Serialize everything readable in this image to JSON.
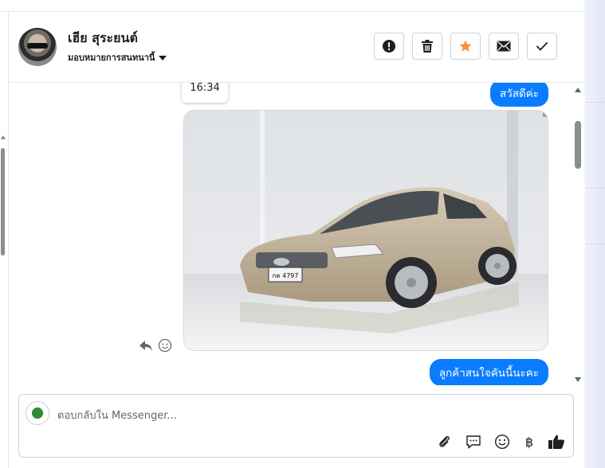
{
  "contact": {
    "name": "เฮีย สุระยนต์",
    "assign_label": "มอบหมายการสนทนานี้"
  },
  "header_actions": [
    {
      "name": "spam-button",
      "icon": "alert-circle-icon"
    },
    {
      "name": "delete-button",
      "icon": "trash-icon"
    },
    {
      "name": "star-button",
      "icon": "star-icon",
      "color": "#f7923b"
    },
    {
      "name": "mark-unread-button",
      "icon": "envelope-icon"
    },
    {
      "name": "mark-done-button",
      "icon": "check-icon"
    }
  ],
  "conversation": {
    "timestamp": "16:34",
    "messages": [
      {
        "type": "text",
        "from": "page",
        "text": "สวัสดีค่ะ"
      },
      {
        "type": "image",
        "from": "page",
        "plate_text": "กต 4797"
      },
      {
        "type": "text",
        "from": "page",
        "text": "ลูกค้าสนใจคันนี้นะคะ"
      }
    ]
  },
  "composer": {
    "placeholder": "ตอบกลับใน Messenger...",
    "tools": [
      "paperclip-icon",
      "saved-reply-icon",
      "emoji-icon",
      "baht-icon",
      "thumbs-up-icon"
    ],
    "baht_symbol": "฿"
  },
  "colors": {
    "bubble": "#0a7cff",
    "star": "#f7923b"
  }
}
